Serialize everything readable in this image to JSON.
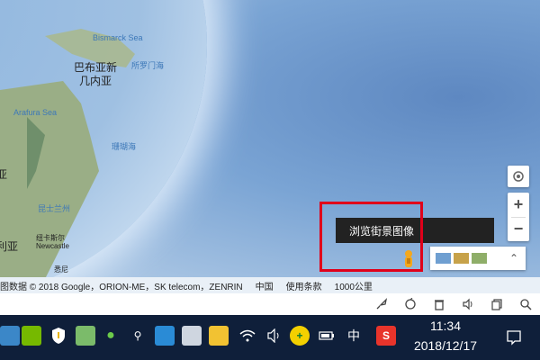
{
  "map": {
    "labels": {
      "bismarck_sea": "Bismarck Sea",
      "png": "巴布亚新几内亚",
      "png_line1": "巴布亚新",
      "png_line2": "几内亚",
      "partial_label": "所罗门海",
      "arafura_sea": "Arafura Sea",
      "coral_sea": "珊瑚海",
      "australia": "利亚",
      "region_left": "亚",
      "region_label": "昆士兰州",
      "newcastle_cn": "纽卡斯尔",
      "newcastle": "Newcastle",
      "sydney": "悉尼"
    },
    "controls": {
      "location_icon": "target-icon",
      "zoom_in": "+",
      "zoom_out": "−",
      "expand": "⌃"
    },
    "tooltip": "浏览街景图像",
    "layers": {
      "thumb_colors": [
        "#6f9fd1",
        "#c7a24a",
        "#8fae69"
      ]
    }
  },
  "attribution": {
    "copyright": "图数据 © 2018 Google，ORION-ME，SK telecom，ZENRIN",
    "country": "中国",
    "terms": "使用条款",
    "scale": "1000公里"
  },
  "toolbar": {
    "icons": [
      "rocket-icon",
      "refresh-icon",
      "trash-icon",
      "volume-icon",
      "copy-icon",
      "search-icon"
    ]
  },
  "taskbar": {
    "time": "11:34",
    "date": "2018/12/17",
    "ime": "中",
    "sogou": "S"
  }
}
